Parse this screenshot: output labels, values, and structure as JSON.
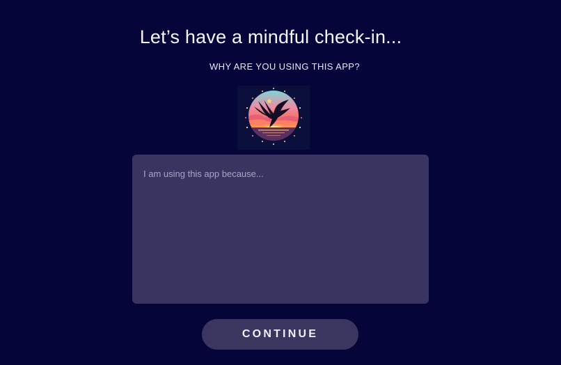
{
  "header": {
    "title": "Let’s have a mindful check-in...",
    "subtitle": "WHY ARE YOU USING THIS APP?"
  },
  "logo": {
    "icon": "bird-sunset-logo-icon"
  },
  "form": {
    "reason_value": "",
    "reason_placeholder": "I am using this app because..."
  },
  "actions": {
    "continue_label": "CONTINUE"
  },
  "colors": {
    "background": "#05053a",
    "input_bg": "#393560",
    "button_bg": "#3a365f",
    "placeholder": "#a9a6c6"
  }
}
